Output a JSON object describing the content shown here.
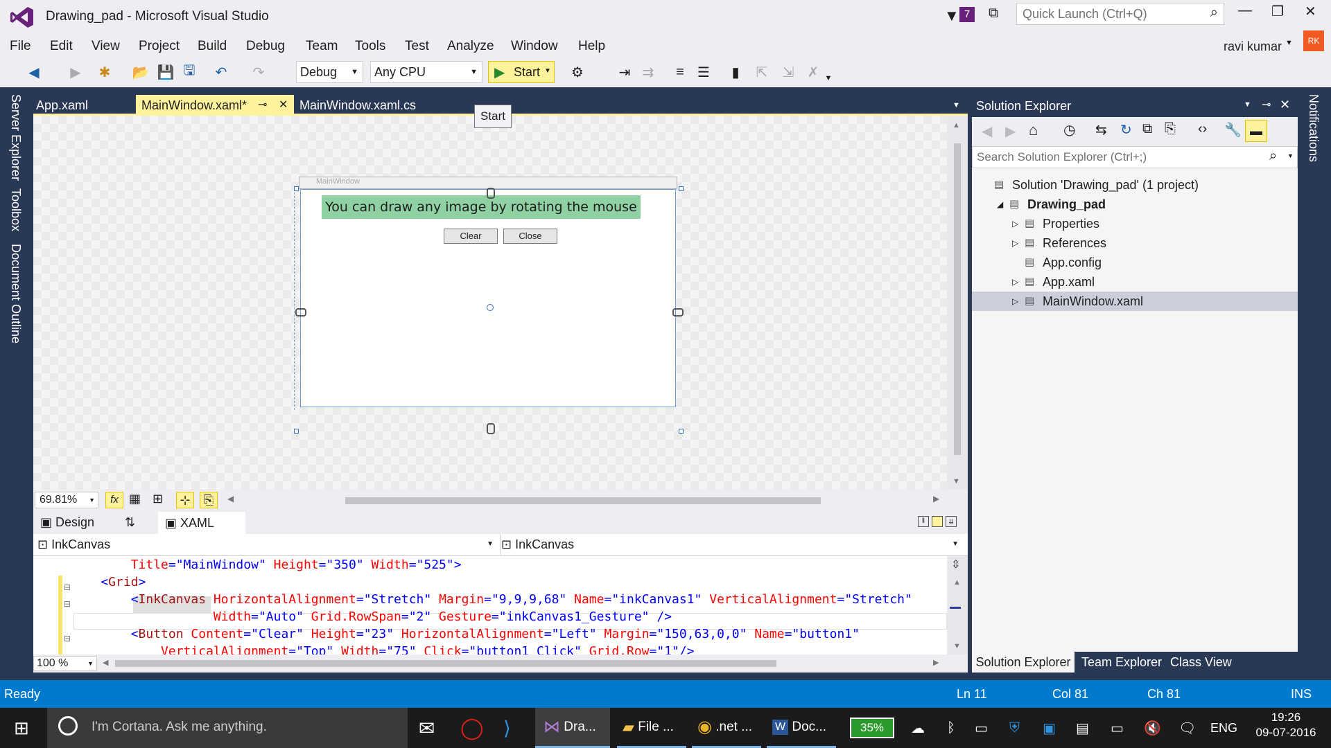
{
  "window": {
    "title": "Drawing_pad - Microsoft Visual Studio",
    "notification_count": "7",
    "quick_launch_placeholder": "Quick Launch (Ctrl+Q)",
    "user_name": "ravi kumar",
    "user_initials": "RK"
  },
  "menu": [
    "File",
    "Edit",
    "View",
    "Project",
    "Build",
    "Debug",
    "Team",
    "Tools",
    "Test",
    "Analyze",
    "Window",
    "Help"
  ],
  "toolbar": {
    "config": "Debug",
    "platform": "Any CPU",
    "start_label": "Start",
    "tooltip": "Start"
  },
  "left_rail": [
    "Server Explorer",
    "Toolbox",
    "Document Outline"
  ],
  "right_rail": [
    "Notifications"
  ],
  "doc_tabs": [
    {
      "label": "App.xaml",
      "active": false
    },
    {
      "label": "MainWindow.xaml*",
      "active": true,
      "pin": "⊸",
      "close": "✕"
    },
    {
      "label": "MainWindow.xaml.cs",
      "active": false
    }
  ],
  "designer": {
    "window_title": "MainWindow",
    "banner_text": "You can draw any image by rotating the mouse",
    "clear_label": "Clear",
    "close_label": "Close",
    "zoom": "69.81%",
    "fx_label": "fx"
  },
  "split_tabs": {
    "design": "Design",
    "swap": "⇅",
    "xaml": "XAML"
  },
  "xaml_nav": {
    "left": "InkCanvas",
    "right": "InkCanvas"
  },
  "code_lines": [
    {
      "indent": "        ",
      "parts": [
        [
          "at",
          "Title"
        ],
        [
          "br",
          "="
        ],
        [
          "vl",
          "\"MainWindow\""
        ],
        [
          "at",
          " Height"
        ],
        [
          "br",
          "="
        ],
        [
          "vl",
          "\"350\""
        ],
        [
          "at",
          " Width"
        ],
        [
          "br",
          "="
        ],
        [
          "vl",
          "\"525\""
        ],
        [
          "br",
          ">"
        ]
      ]
    },
    {
      "indent": "    ",
      "parts": [
        [
          "br",
          "<"
        ],
        [
          "tg",
          "Grid"
        ],
        [
          "br",
          ">"
        ]
      ]
    },
    {
      "indent": "        ",
      "parts": [
        [
          "br",
          "<"
        ],
        [
          "tg",
          "InkCanvas"
        ],
        [
          "at",
          " HorizontalAlignment"
        ],
        [
          "br",
          "="
        ],
        [
          "vl",
          "\"Stretch\""
        ],
        [
          "at",
          " Margin"
        ],
        [
          "br",
          "="
        ],
        [
          "vl",
          "\"9,9,9,68\""
        ],
        [
          "at",
          " Name"
        ],
        [
          "br",
          "="
        ],
        [
          "vl",
          "\"inkCanvas1\""
        ],
        [
          "at",
          " VerticalAlignment"
        ],
        [
          "br",
          "="
        ],
        [
          "vl",
          "\"Stretch\""
        ]
      ]
    },
    {
      "indent": "                   ",
      "parts": [
        [
          "at",
          "Width"
        ],
        [
          "br",
          "="
        ],
        [
          "vl",
          "\"Auto\""
        ],
        [
          "at",
          " Grid.RowSpan"
        ],
        [
          "br",
          "="
        ],
        [
          "vl",
          "\"2\""
        ],
        [
          "at",
          " Gesture"
        ],
        [
          "br",
          "="
        ],
        [
          "vl",
          "\"inkCanvas1_Gesture\""
        ],
        [
          "br",
          " />"
        ]
      ]
    },
    {
      "indent": "        ",
      "parts": [
        [
          "br",
          "<"
        ],
        [
          "tg",
          "Button"
        ],
        [
          "at",
          " Content"
        ],
        [
          "br",
          "="
        ],
        [
          "vl",
          "\"Clear\""
        ],
        [
          "at",
          " Height"
        ],
        [
          "br",
          "="
        ],
        [
          "vl",
          "\"23\""
        ],
        [
          "at",
          " HorizontalAlignment"
        ],
        [
          "br",
          "="
        ],
        [
          "vl",
          "\"Left\""
        ],
        [
          "at",
          " Margin"
        ],
        [
          "br",
          "="
        ],
        [
          "vl",
          "\"150,63,0,0\""
        ],
        [
          "at",
          " Name"
        ],
        [
          "br",
          "="
        ],
        [
          "vl",
          "\"button1\""
        ]
      ]
    },
    {
      "indent": "            ",
      "parts": [
        [
          "at",
          "VerticalAlignment"
        ],
        [
          "br",
          "="
        ],
        [
          "vl",
          "\"Top\""
        ],
        [
          "at",
          " Width"
        ],
        [
          "br",
          "="
        ],
        [
          "vl",
          "\"75\""
        ],
        [
          "at",
          " Click"
        ],
        [
          "br",
          "="
        ],
        [
          "vl",
          "\"button1_Click\""
        ],
        [
          "at",
          " Grid.Row"
        ],
        [
          "br",
          "="
        ],
        [
          "vl",
          "\"1\""
        ],
        [
          "br",
          "/>"
        ]
      ]
    }
  ],
  "code_zoom": "100 %",
  "solution_explorer": {
    "title": "Solution Explorer",
    "search_placeholder": "Search Solution Explorer (Ctrl+;)",
    "items": [
      {
        "label": "Solution 'Drawing_pad' (1 project)",
        "level": 0,
        "expander": ""
      },
      {
        "label": "Drawing_pad",
        "level": 1,
        "expander": "◢",
        "bold": true
      },
      {
        "label": "Properties",
        "level": 2,
        "expander": "▷"
      },
      {
        "label": "References",
        "level": 2,
        "expander": "▷"
      },
      {
        "label": "App.config",
        "level": 2,
        "expander": ""
      },
      {
        "label": "App.xaml",
        "level": 2,
        "expander": "▷"
      },
      {
        "label": "MainWindow.xaml",
        "level": 2,
        "expander": "▷",
        "selected": true
      }
    ],
    "bottom_tabs": [
      "Solution Explorer",
      "Team Explorer",
      "Class View"
    ]
  },
  "status": {
    "state": "Ready",
    "ln": "Ln 11",
    "col": "Col 81",
    "ch": "Ch 81",
    "mode": "INS"
  },
  "taskbar": {
    "cortana": "I'm Cortana. Ask me anything.",
    "apps": [
      "Dra...",
      "File ...",
      ".net ...",
      "Doc..."
    ],
    "battery": "35%",
    "lang": "ENG",
    "time": "19:26",
    "date": "09-07-2016"
  },
  "colors": {
    "accent": "#007acc",
    "vs_purple": "#68217a",
    "dark_frame": "#293955",
    "tab_active": "#fff29d"
  }
}
